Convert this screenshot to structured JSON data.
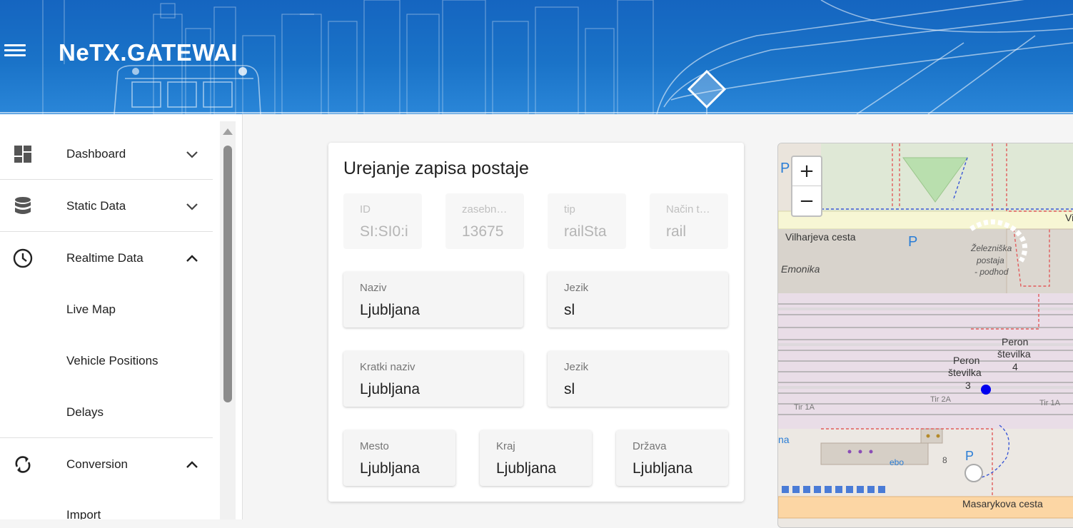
{
  "header": {
    "app_title": "NeTX.GATEWAI",
    "menu_icon": "menu-icon",
    "brand_color": "#1565c0"
  },
  "sidebar": {
    "items": [
      {
        "label": "Dashboard",
        "icon": "dashboard-icon",
        "expanded": false
      },
      {
        "label": "Static Data",
        "icon": "database-icon",
        "expanded": false
      },
      {
        "label": "Realtime Data",
        "icon": "clock-icon",
        "expanded": true
      },
      {
        "label": "Live Map"
      },
      {
        "label": "Vehicle Positions"
      },
      {
        "label": "Delays"
      },
      {
        "label": "Conversion",
        "icon": "sync-icon",
        "expanded": true
      },
      {
        "label": "Import"
      }
    ]
  },
  "form": {
    "title": "Urejanje zapisa postaje",
    "fields": {
      "id": {
        "label": "ID",
        "value": "SI:SI0:i"
      },
      "zasebni": {
        "label": "zasebn…",
        "value": "13675"
      },
      "tip": {
        "label": "tip",
        "value": "railSta"
      },
      "nacin": {
        "label": "Način t…",
        "value": "rail"
      },
      "naziv": {
        "label": "Naziv",
        "value": "Ljubljana"
      },
      "jezik1": {
        "label": "Jezik",
        "value": "sl"
      },
      "kratki": {
        "label": "Kratki naziv",
        "value": "Ljubljana"
      },
      "jezik2": {
        "label": "Jezik",
        "value": "sl"
      },
      "mesto": {
        "label": "Mesto",
        "value": "Ljubljana"
      },
      "kraj": {
        "label": "Kraj",
        "value": "Ljubljana"
      },
      "drzava": {
        "label": "Država",
        "value": "Ljubljana"
      }
    }
  },
  "map": {
    "zoom_in": "+",
    "zoom_out": "−",
    "labels": {
      "street1": "Vilharjeva cesta",
      "street1_edge": "Vil",
      "street2": "Masarykova cesta",
      "emonika": "Emonika",
      "parking": "P",
      "station1": "Železniška",
      "station2": "postaja",
      "station3": "- podhod",
      "peron3a": "Peron",
      "peron3b": "številka",
      "peron3c": "3",
      "peron4a": "Peron",
      "peron4b": "številka",
      "peron4c": "4",
      "tir1a": "Tir 1A",
      "tir2a": "Tir 2A",
      "tira": "Tir 1A",
      "ebo": "ebo",
      "na": "na",
      "num8": "8"
    },
    "marker_color": "#0000ee"
  }
}
